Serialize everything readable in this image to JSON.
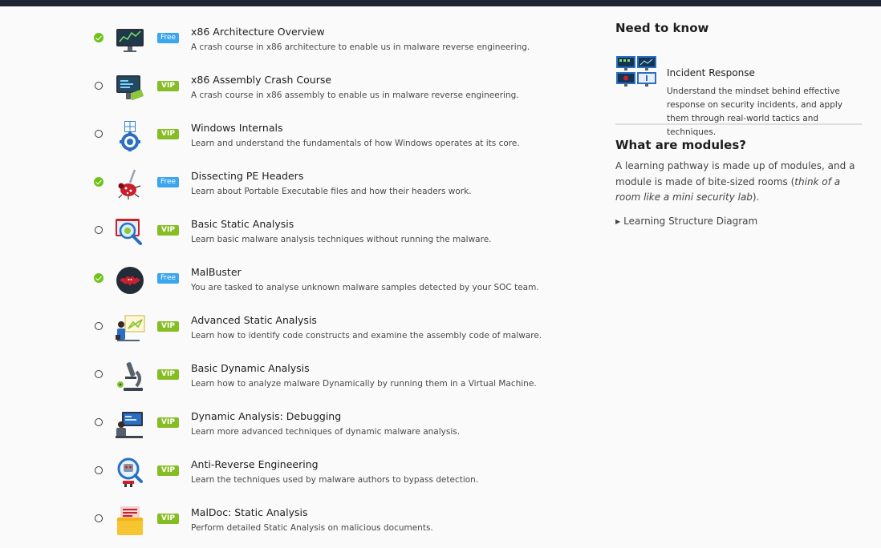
{
  "rooms": [
    {
      "title": "x86 Architecture Overview",
      "desc": "A crash course in x86 architecture to enable us in malware reverse engineering.",
      "badge": "Free",
      "completed": true,
      "icon": "monitor-graph-icon"
    },
    {
      "title": "x86 Assembly Crash Course",
      "desc": "A crash course in x86 assembly to enable us in malware reverse engineering.",
      "badge": "VIP",
      "completed": false,
      "icon": "monitor-tools-icon"
    },
    {
      "title": "Windows Internals",
      "desc": "Learn and understand the fundamentals of how Windows operates at its core.",
      "badge": "VIP",
      "completed": false,
      "icon": "windows-gear-icon"
    },
    {
      "title": "Dissecting PE Headers",
      "desc": "Learn about Portable Executable files and how their headers work.",
      "badge": "Free",
      "completed": true,
      "icon": "bug-scalpel-icon"
    },
    {
      "title": "Basic Static Analysis",
      "desc": "Learn basic malware analysis techniques without running the malware.",
      "badge": "VIP",
      "completed": false,
      "icon": "magnifier-virus-icon"
    },
    {
      "title": "MalBuster",
      "desc": "You are tasked to analyse unknown malware samples detected by your SOC team.",
      "badge": "Free",
      "completed": true,
      "icon": "bat-logo-icon"
    },
    {
      "title": "Advanced Static Analysis",
      "desc": "Learn how to identify code constructs and examine the assembly code of malware.",
      "badge": "VIP",
      "completed": false,
      "icon": "analyst-board-icon"
    },
    {
      "title": "Basic Dynamic Analysis",
      "desc": "Learn how to analyze malware Dynamically by running them in a Virtual Machine.",
      "badge": "VIP",
      "completed": false,
      "icon": "microscope-icon"
    },
    {
      "title": "Dynamic Analysis: Debugging",
      "desc": "Learn more advanced techniques of dynamic malware analysis.",
      "badge": "VIP",
      "completed": false,
      "icon": "debugger-desk-icon"
    },
    {
      "title": "Anti-Reverse Engineering",
      "desc": "Learn the techniques used by malware authors to bypass detection.",
      "badge": "VIP",
      "completed": false,
      "icon": "magnifier-robot-icon"
    },
    {
      "title": "MalDoc: Static Analysis",
      "desc": "Perform detailed Static Analysis on malicious documents.",
      "badge": "VIP",
      "completed": false,
      "icon": "document-folder-icon"
    }
  ],
  "sidebar": {
    "need_to_know_heading": "Need to know",
    "module": {
      "title": "Incident Response",
      "desc": "Understand the mindset behind effective response on security incidents, and apply them through real-world tactics and techniques.",
      "icon": "monitors-grid-icon"
    },
    "what_heading": "What are modules?",
    "what_text_plain": "A learning pathway is made up of modules, and a module is made of bite-sized rooms (",
    "what_text_em": "think of a room like a mini security lab",
    "what_text_end": ").",
    "details_label": "Learning Structure Diagram"
  },
  "colors": {
    "free_badge": "#3ba5ef",
    "vip_badge": "#87bd24",
    "completed": "#6fc21a",
    "topbar": "#1c2538"
  }
}
